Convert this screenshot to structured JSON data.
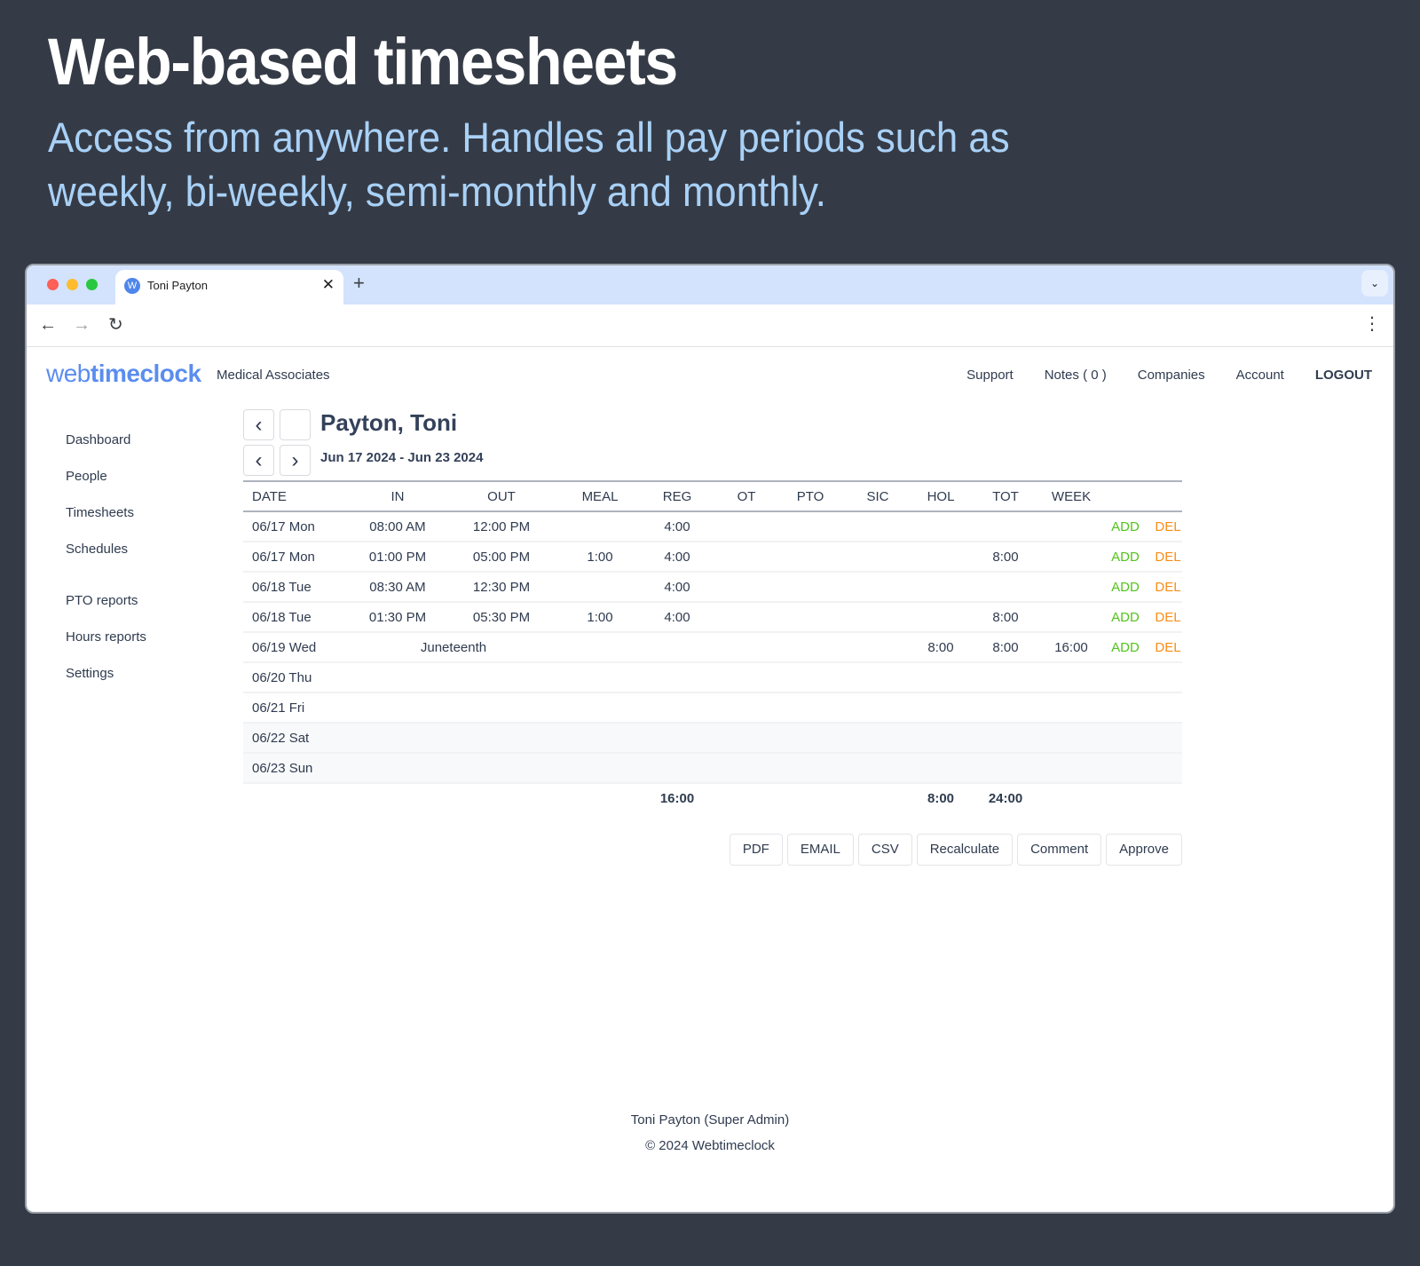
{
  "hero": {
    "title": "Web-based timesheets",
    "subtitle": "Access from anywhere. Handles all pay periods such as weekly, bi-weekly, semi-monthly and monthly."
  },
  "browser": {
    "tab_title": "Toni Payton",
    "tab_favicon_letter": "W",
    "close_glyph": "✕",
    "new_tab_glyph": "+",
    "tab_search_glyph": "⌄",
    "back_glyph": "←",
    "forward_glyph": "→",
    "reload_glyph": "↻",
    "menu_glyph": "⋮"
  },
  "app": {
    "logo_light": "web",
    "logo_bold": "timeclock",
    "company": "Medical Associates",
    "topnav": [
      "Support",
      "Notes ( 0 )",
      "Companies",
      "Account",
      "LOGOUT"
    ],
    "sidebar": {
      "group1": [
        "Dashboard",
        "People",
        "Timesheets",
        "Schedules"
      ],
      "group2": [
        "PTO reports",
        "Hours reports",
        "Settings"
      ]
    },
    "employee_name": "Payton, Toni",
    "period": "Jun 17 2024 - Jun 23 2024",
    "prev_glyph": "‹",
    "next_glyph": "›"
  },
  "timesheet": {
    "columns": [
      "DATE",
      "IN",
      "OUT",
      "MEAL",
      "REG",
      "OT",
      "PTO",
      "SIC",
      "HOL",
      "TOT",
      "WEEK",
      "",
      ""
    ],
    "add_label": "ADD",
    "del_label": "DEL",
    "rows": [
      {
        "date": "06/17 Mon",
        "in": "08:00 AM",
        "out": "12:00 PM",
        "meal": "",
        "reg": "4:00",
        "ot": "",
        "pto": "",
        "sic": "",
        "hol": "",
        "tot": "",
        "week": "",
        "actions": true,
        "weekend": false
      },
      {
        "date": "06/17 Mon",
        "in": "01:00 PM",
        "out": "05:00 PM",
        "meal": "1:00",
        "reg": "4:00",
        "ot": "",
        "pto": "",
        "sic": "",
        "hol": "",
        "tot": "8:00",
        "week": "",
        "actions": true,
        "weekend": false
      },
      {
        "date": "06/18 Tue",
        "in": "08:30 AM",
        "out": "12:30 PM",
        "meal": "",
        "reg": "4:00",
        "ot": "",
        "pto": "",
        "sic": "",
        "hol": "",
        "tot": "",
        "week": "",
        "actions": true,
        "weekend": false
      },
      {
        "date": "06/18 Tue",
        "in": "01:30 PM",
        "out": "05:30 PM",
        "meal": "1:00",
        "reg": "4:00",
        "ot": "",
        "pto": "",
        "sic": "",
        "hol": "",
        "tot": "8:00",
        "week": "",
        "actions": true,
        "weekend": false
      },
      {
        "date": "06/19 Wed",
        "holiday": "Juneteenth",
        "meal": "",
        "reg": "",
        "ot": "",
        "pto": "",
        "sic": "",
        "hol": "8:00",
        "tot": "8:00",
        "week": "16:00",
        "actions": true,
        "weekend": false
      },
      {
        "date": "06/20 Thu",
        "actions": false,
        "weekend": false
      },
      {
        "date": "06/21 Fri",
        "actions": false,
        "weekend": false
      },
      {
        "date": "06/22 Sat",
        "actions": false,
        "weekend": true
      },
      {
        "date": "06/23 Sun",
        "actions": false,
        "weekend": true
      }
    ],
    "totals": {
      "reg": "16:00",
      "hol": "8:00",
      "tot": "24:00"
    }
  },
  "actions": [
    "PDF",
    "EMAIL",
    "CSV",
    "Recalculate",
    "Comment",
    "Approve"
  ],
  "footer": {
    "user": "Toni Payton (Super Admin)",
    "copyright": "© 2024 Webtimeclock"
  },
  "colors": {
    "add": "#52c41a",
    "del": "#fa8c16",
    "brand": "#5b8def"
  }
}
